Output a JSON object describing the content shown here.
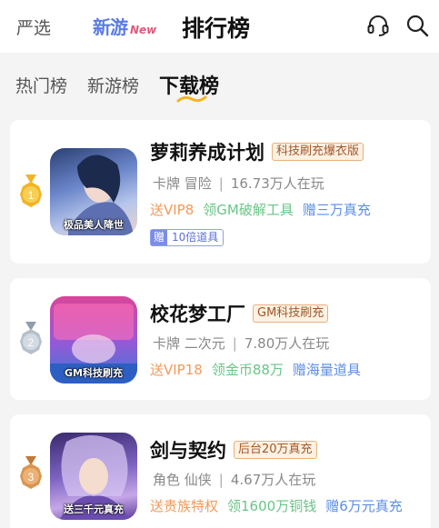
{
  "header": {
    "tab_yanxuan": "严选",
    "xinyou_cn": "新游",
    "xinyou_new": "New",
    "tab_paihang": "排行榜",
    "icons": [
      "headset-icon",
      "search-icon"
    ]
  },
  "subtabs": {
    "items": [
      {
        "label": "热门榜"
      },
      {
        "label": "新游榜"
      },
      {
        "label": "下载榜"
      }
    ],
    "active": "下载榜"
  },
  "games": [
    {
      "rank": "1",
      "title": "萝莉养成计划",
      "tag": "科技刷充爆衣版",
      "genre": "卡牌 冒险",
      "players": "16.73万人在玩",
      "perks": [
        "送VIP8",
        "领GM破解工具",
        "赠三万真充"
      ],
      "badge_prefix": "赠",
      "badge_text": "10倍道具",
      "thumb_caption": "极品美人降世",
      "medal_color": "#f2b423"
    },
    {
      "rank": "2",
      "title": "校花梦工厂",
      "tag": "GM科技刷充",
      "genre": "卡牌 二次元",
      "players": "7.80万人在玩",
      "perks": [
        "送VIP18",
        "领金币88万",
        "赠海量道具"
      ],
      "thumb_caption": "GM科技刷充",
      "medal_color": "#b5c0cc"
    },
    {
      "rank": "3",
      "title": "剑与契约",
      "tag": "后台20万真充",
      "genre": "角色 仙侠",
      "players": "4.67万人在玩",
      "perks": [
        "送贵族特权",
        "领1600万铜钱",
        "赠6万元真充"
      ],
      "thumb_caption": "送三千元真充",
      "medal_color": "#d9954e"
    }
  ],
  "colors": {
    "accent_orange": "#f29a5b",
    "accent_green": "#69c586",
    "accent_blue": "#5b8ee6",
    "tag_brown": "#a1562a"
  }
}
